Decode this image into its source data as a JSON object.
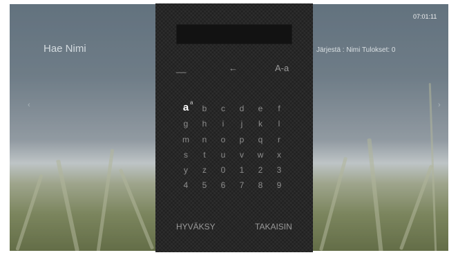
{
  "header": {
    "title": "Hae Nimi",
    "clock": "07:01:11",
    "sort_info": "Järjestä : Nimi Tulokset: 0"
  },
  "keyboard": {
    "search_value": "",
    "space_key": "__",
    "backspace_key": "←",
    "case_key": "A-a",
    "keys": [
      "a",
      "b",
      "c",
      "d",
      "e",
      "f",
      "g",
      "h",
      "i",
      "j",
      "k",
      "l",
      "m",
      "n",
      "o",
      "p",
      "q",
      "r",
      "s",
      "t",
      "u",
      "v",
      "w",
      "x",
      "y",
      "z",
      "0",
      "1",
      "2",
      "3",
      "4",
      "5",
      "6",
      "7",
      "8",
      "9"
    ],
    "selected_key": "a",
    "selected_marker": "a",
    "accept_label": "HYVÄKSY",
    "back_label": "TAKAISIN"
  },
  "nav": {
    "left_arrow": "‹",
    "right_arrow": "›"
  }
}
